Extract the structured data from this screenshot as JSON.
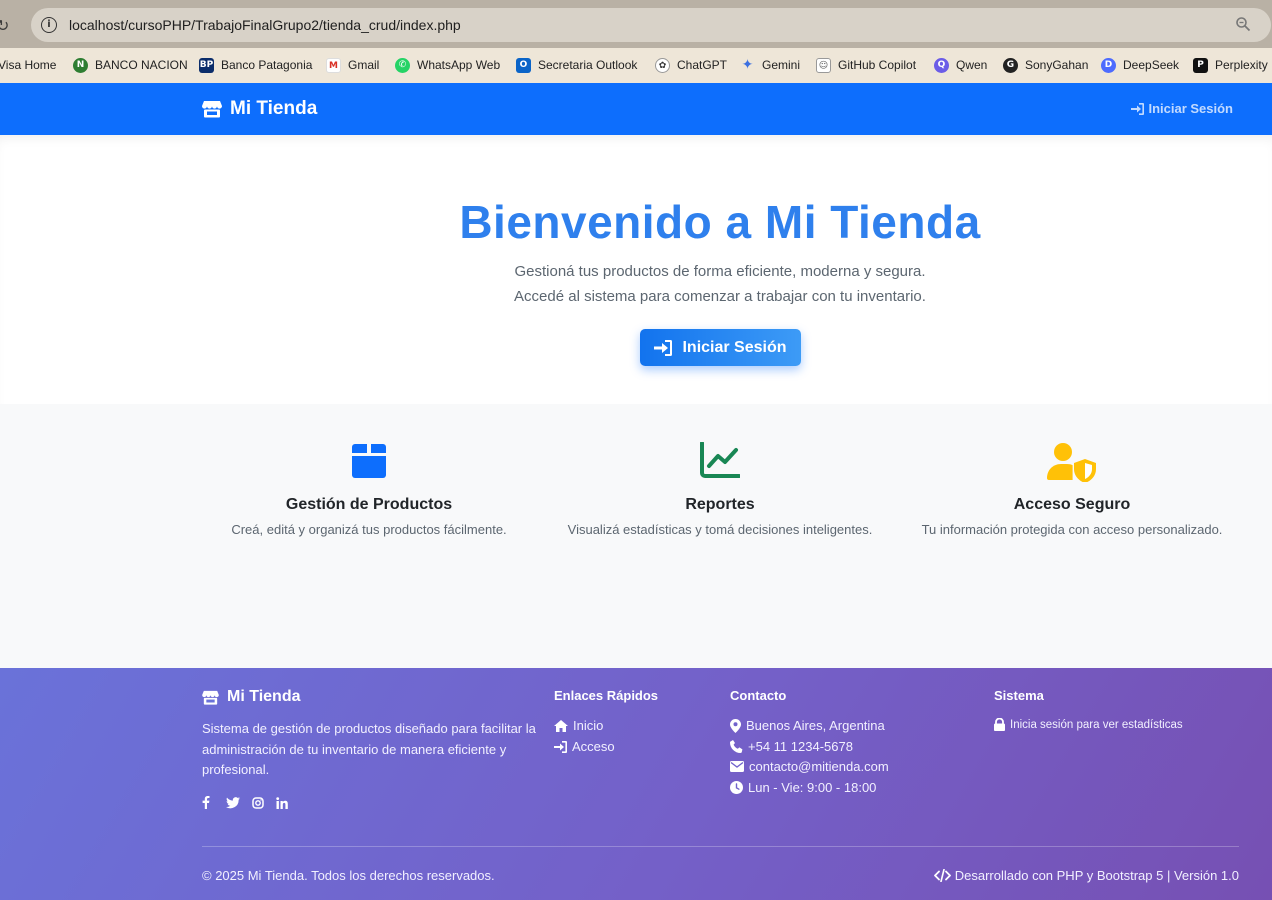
{
  "browser": {
    "url": "localhost/cursoPHP/TrabajoFinalGrupo2/tienda_crud/index.php",
    "bookmarks": [
      {
        "label": "Visa Home",
        "icon": "visa-icon"
      },
      {
        "label": "BANCO NACION",
        "icon": "banco-nacion-icon"
      },
      {
        "label": "Banco Patagonia",
        "icon": "banco-patagonia-icon"
      },
      {
        "label": "Gmail",
        "icon": "gmail-icon"
      },
      {
        "label": "WhatsApp Web",
        "icon": "whatsapp-icon"
      },
      {
        "label": "Secretaria Outlook",
        "icon": "outlook-icon"
      },
      {
        "label": "ChatGPT",
        "icon": "chatgpt-icon"
      },
      {
        "label": "Gemini",
        "icon": "gemini-icon"
      },
      {
        "label": "GitHub Copilot",
        "icon": "copilot-icon"
      },
      {
        "label": "Qwen",
        "icon": "qwen-icon"
      },
      {
        "label": "SonyGahan",
        "icon": "github-icon"
      },
      {
        "label": "DeepSeek",
        "icon": "deepseek-icon"
      },
      {
        "label": "Perplexity",
        "icon": "perplexity-icon"
      }
    ]
  },
  "navbar": {
    "brand": "Mi Tienda",
    "login_label": "Iniciar Sesión"
  },
  "hero": {
    "title": "Bienvenido a Mi Tienda",
    "subtitle_line1": "Gestioná tus productos de forma eficiente, moderna y segura.",
    "subtitle_line2": "Accedé al sistema para comenzar a trabajar con tu inventario.",
    "button_label": "Iniciar Sesión"
  },
  "features": [
    {
      "title": "Gestión de Productos",
      "text": "Creá, editá y organizá tus productos fácilmente.",
      "icon": "box-icon",
      "color": "#0d6efd"
    },
    {
      "title": "Reportes",
      "text": "Visualizá estadísticas y tomá decisiones inteligentes.",
      "icon": "chart-line-icon",
      "color": "#198754"
    },
    {
      "title": "Acceso Seguro",
      "text": "Tu información protegida con acceso personalizado.",
      "icon": "user-shield-icon",
      "color": "#ffc107"
    }
  ],
  "footer": {
    "brand": "Mi Tienda",
    "description": "Sistema de gestión de productos diseñado para facilitar la administración de tu inventario de manera eficiente y profesional.",
    "quick_links_title": "Enlaces Rápidos",
    "quick_links": [
      {
        "label": "Inicio",
        "icon": "home-icon"
      },
      {
        "label": "Acceso",
        "icon": "sign-in-icon"
      }
    ],
    "contact_title": "Contacto",
    "contact": [
      {
        "label": "Buenos Aires, Argentina",
        "icon": "map-marker-icon"
      },
      {
        "label": "+54 11 1234-5678",
        "icon": "phone-icon"
      },
      {
        "label": "contacto@mitienda.com",
        "icon": "envelope-icon"
      },
      {
        "label": "Lun - Vie: 9:00 - 18:00",
        "icon": "clock-icon"
      }
    ],
    "system_title": "Sistema",
    "system_text": "Inicia sesión para ver estadísticas",
    "copyright": "© 2025 Mi Tienda. Todos los derechos reservados.",
    "credit": "Desarrollado con PHP y Bootstrap 5 | Versión 1.0"
  }
}
